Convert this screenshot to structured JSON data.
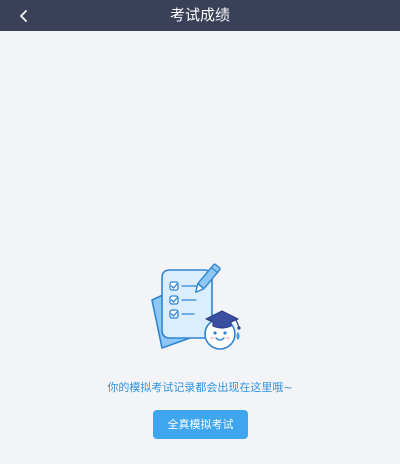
{
  "header": {
    "title": "考试成绩",
    "back_icon": "chevron-left-icon"
  },
  "empty_state": {
    "illustration": "exam-checklist-with-graduate-face-illustration",
    "message": "你的模拟考试记录都会出现在这里哦~",
    "button_label": "全真模拟考试"
  },
  "colors": {
    "header_bg": "#3a4057",
    "page_bg": "#f3f4f8",
    "accent": "#3da6ee",
    "message_text": "#2f93df"
  }
}
